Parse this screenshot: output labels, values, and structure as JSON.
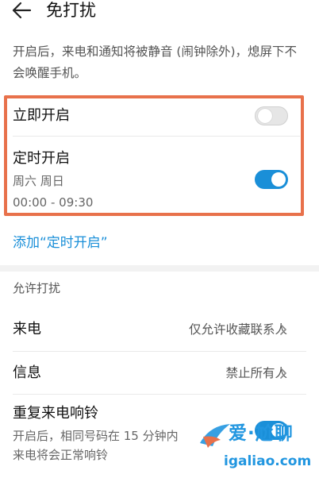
{
  "header": {
    "title": "免打扰"
  },
  "description": "开启后，来电和通知将被静音 (闹钟除外)，熄屏下不会唤醒手机。",
  "settings": {
    "enable_now": {
      "label": "立即开启",
      "enabled": false
    },
    "scheduled": {
      "label": "定时开启",
      "days": "周六 周日",
      "time_range": "00:00 - 09:30",
      "enabled": true
    },
    "add_schedule_label": "添加“定时开启”"
  },
  "allow_section": {
    "header": "允许打扰",
    "items": [
      {
        "label": "来电",
        "value": "仅允许收藏联系人"
      },
      {
        "label": "信息",
        "value": "禁止所有人"
      }
    ],
    "repeat_call": {
      "label": "重复来电响铃",
      "description_line1": "开启后，相同号码在 15 分钟内",
      "description_line2": "来电将会正常响铃",
      "enabled": true
    }
  },
  "watermark": {
    "top_text": "爱·尬聊",
    "url": "igaliao.com"
  },
  "colors": {
    "accent": "#1a8fd8",
    "highlight_border": "#e8714b",
    "toggle_off": "#e6e6e6"
  }
}
